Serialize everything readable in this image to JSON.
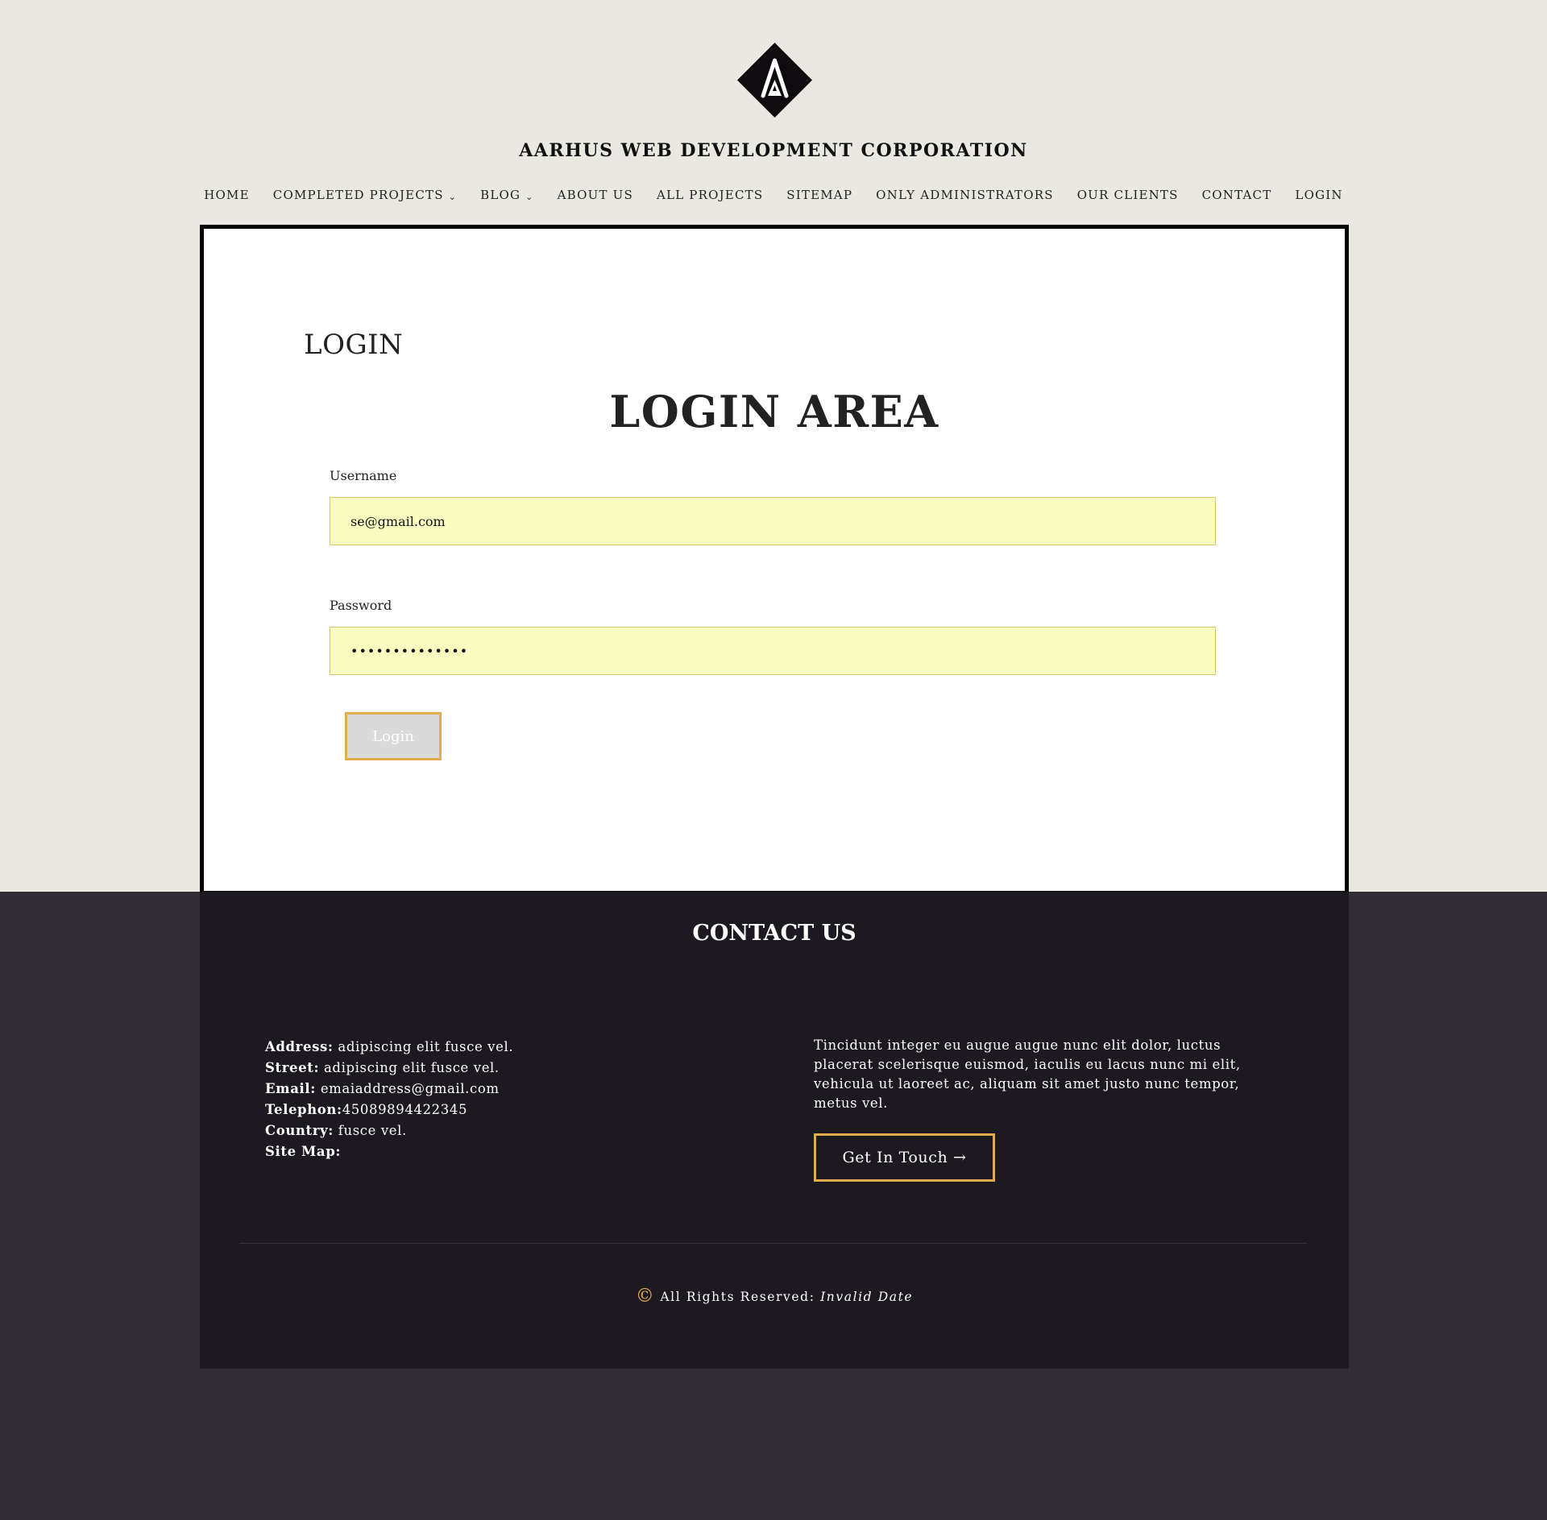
{
  "site": {
    "title": "AARHUS WEB DEVELOPMENT CORPORATION",
    "logo_icon": "diamond-a-logo-icon"
  },
  "nav": {
    "items": [
      {
        "label": "HOME",
        "dropdown": false
      },
      {
        "label": "COMPLETED PROJECTS",
        "dropdown": true
      },
      {
        "label": "BLOG",
        "dropdown": true
      },
      {
        "label": "ABOUT US",
        "dropdown": false
      },
      {
        "label": "ALL PROJECTS",
        "dropdown": false
      },
      {
        "label": "SITEMAP",
        "dropdown": false
      },
      {
        "label": "ONLY ADMINISTRATORS",
        "dropdown": false
      },
      {
        "label": "OUR CLIENTS",
        "dropdown": false
      },
      {
        "label": "CONTACT",
        "dropdown": false
      },
      {
        "label": "LOGIN",
        "dropdown": false
      }
    ],
    "dropdown_glyph": "⌄"
  },
  "main": {
    "page_heading": "LOGIN",
    "area_heading": "LOGIN AREA",
    "username": {
      "label": "Username",
      "value": "se@gmail.com"
    },
    "password": {
      "label": "Password",
      "value": "••••••••••••••"
    },
    "login_button": "Login"
  },
  "footer": {
    "title": "CONTACT US",
    "contact": {
      "address_key": "Address:",
      "address_val": " adipiscing elit fusce vel.",
      "street_key": "Street:",
      "street_val": " adipiscing elit fusce vel.",
      "email_key": "Email:",
      "email_val": " emaiaddress@gmail.com",
      "telephone_key": "Telephon:",
      "telephone_val": "45089894422345",
      "country_key": "Country:",
      "country_val": " fusce vel.",
      "sitemap_key": "Site Map:"
    },
    "text": "Tincidunt integer eu augue augue nunc elit dolor, luctus placerat scelerisque euismod, iaculis eu lacus nunc mi elit, vehicula ut laoreet ac, aliquam sit amet justo nunc tempor, metus vel.",
    "touch_button": "Get In Touch →",
    "copyright_symbol": "©",
    "copyright_text": "All Rights Reserved: ",
    "copyright_date": "Invalid Date"
  },
  "colors": {
    "top_background": "#e9e8e1",
    "bottom_background": "#322d34",
    "footer_background": "#1d1920",
    "accent": "#e0ac4e",
    "input_background": "#f9fdbf"
  }
}
